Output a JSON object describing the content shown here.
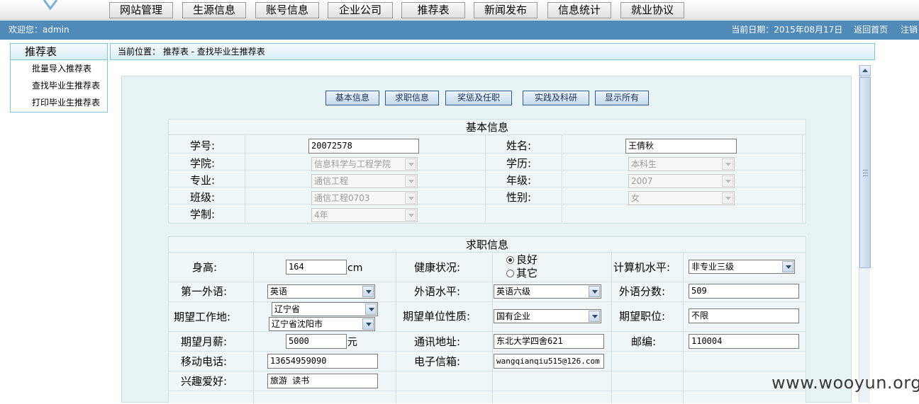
{
  "nav": [
    "网站管理",
    "生源信息",
    "账号信息",
    "企业公司",
    "推荐表",
    "新闻发布",
    "信息统计",
    "就业协议"
  ],
  "header": {
    "welcome": "欢迎您：admin",
    "date_label": "当前日期：2015年08月17日",
    "back_home": "返回首页",
    "logout": "注销"
  },
  "sidebar": {
    "title": "推荐表",
    "items": [
      "批量导入推荐表",
      "查找毕业生推荐表",
      "打印毕业生推荐表"
    ]
  },
  "breadcrumb": "当前位置： 推荐表 -  查找毕业生推荐表",
  "tabs": [
    "基本信息",
    "求职信息",
    "奖惩及任职",
    "实践及科研",
    "显示所有"
  ],
  "basic": {
    "title": "基本信息",
    "student_id_label": "学号:",
    "student_id": "20072578",
    "name_label": "姓名:",
    "name": "王倩秋",
    "college_label": "学院:",
    "college": "信息科学与工程学院",
    "education_label": "学历:",
    "education": "本科生",
    "major_label": "专业:",
    "major": "通信工程",
    "grade_label": "年级:",
    "grade": "2007",
    "class_label": "班级:",
    "class": "通信工程0703",
    "gender_label": "性别:",
    "gender": "女",
    "schooling_label": "学制:",
    "schooling": "4年"
  },
  "job": {
    "title": "求职信息",
    "height_label": "身高:",
    "height": "164",
    "height_unit": "cm",
    "health_label": "健康状况:",
    "health_good": "良好",
    "health_other": "其它",
    "computer_label": "计算机水平:",
    "computer": "非专业三级",
    "language_label": "第一外语:",
    "language": "英语",
    "lang_level_label": "外语水平:",
    "lang_level": "英语六级",
    "lang_score_label": "外语分数:",
    "lang_score": "509",
    "workplace_label": "期望工作地:",
    "province": "辽宁省",
    "city": "辽宁省沈阳市",
    "unit_type_label": "期望单位性质:",
    "unit_type": "国有企业",
    "position_label": "期望职位:",
    "position": "不限",
    "salary_label": "期望月薪:",
    "salary": "5000",
    "salary_unit": "元",
    "address_label": "通讯地址:",
    "address": "东北大学四舍621",
    "zip_label": "邮编:",
    "zip": "110004",
    "mobile_label": "移动电话:",
    "mobile": "13654959090",
    "email_label": "电子信箱:",
    "email": "wangqianqiu515@126.com",
    "hobby_label": "兴趣爱好:",
    "hobby": "旅游 读书"
  },
  "watermark": "www.wooyun.org"
}
